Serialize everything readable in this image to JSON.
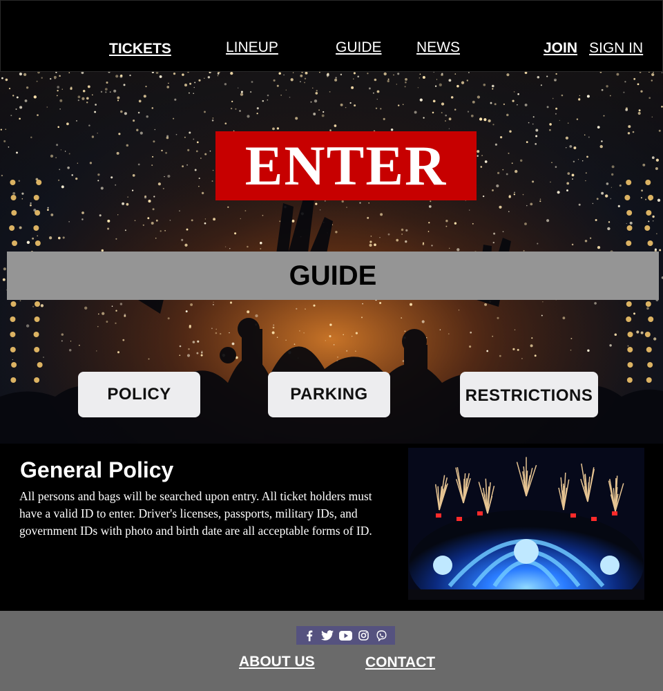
{
  "nav": {
    "tickets": "TICKETS",
    "lineup": "LINEUP",
    "guide": "GUIDE",
    "news": "NEWS",
    "join": "JOIN",
    "sign_in": "SIGN IN"
  },
  "hero": {
    "logo_text": "ENTER",
    "logo_color": "#c70000",
    "banner_title": "GUIDE",
    "buttons": [
      "POLICY",
      "PARKING",
      "RESTRICTIONS"
    ]
  },
  "policy": {
    "heading": "General Policy",
    "body": "All persons and bags will be searched upon entry. All ticket holders must have a valid ID to enter. Driver's licenses, passports, military IDs, and government IDs with photo and birth date are all acceptable forms of ID."
  },
  "footer": {
    "social_icons": [
      "facebook-icon",
      "twitter-icon",
      "youtube-icon",
      "instagram-icon",
      "viber-icon"
    ],
    "about": "ABOUT US",
    "contact": "CONTACT"
  }
}
